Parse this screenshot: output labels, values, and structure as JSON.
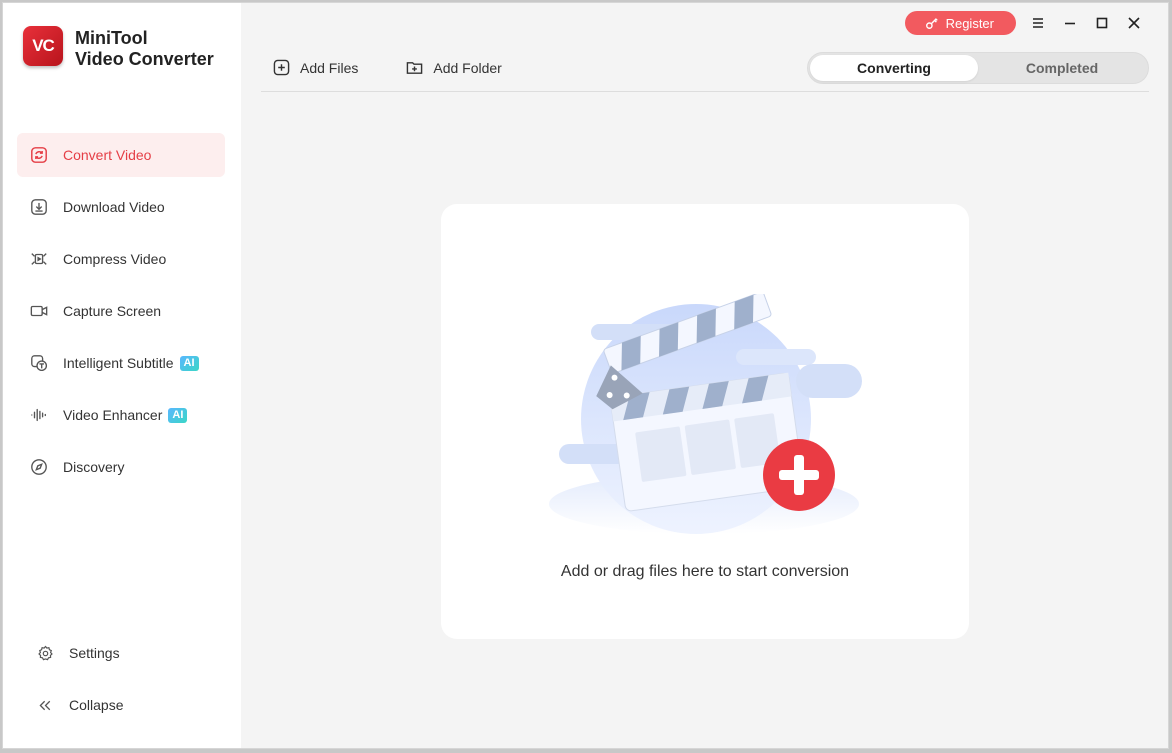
{
  "brand": {
    "logo_text": "VC",
    "line1": "MiniTool",
    "line2": "Video Converter"
  },
  "sidebar": {
    "items": [
      {
        "label": "Convert Video",
        "icon": "convert-icon",
        "active": true
      },
      {
        "label": "Download Video",
        "icon": "download-icon"
      },
      {
        "label": "Compress Video",
        "icon": "compress-icon"
      },
      {
        "label": "Capture Screen",
        "icon": "camera-icon"
      },
      {
        "label": "Intelligent Subtitle",
        "icon": "subtitle-icon",
        "badge": "AI"
      },
      {
        "label": "Video Enhancer",
        "icon": "waveform-icon",
        "badge": "AI"
      },
      {
        "label": "Discovery",
        "icon": "compass-icon"
      }
    ],
    "bottom": {
      "settings_label": "Settings",
      "collapse_label": "Collapse"
    }
  },
  "header": {
    "register_label": "Register"
  },
  "toolbar": {
    "add_files_label": "Add Files",
    "add_folder_label": "Add Folder"
  },
  "tabs": {
    "converting_label": "Converting",
    "completed_label": "Completed",
    "active": "converting"
  },
  "drop_zone": {
    "message": "Add or drag files here to start conversion"
  },
  "colors": {
    "accent": "#e53e46",
    "register_bg": "#f25a5f",
    "active_nav_bg": "#fdeeee",
    "ai_badge": "#3ab6f5"
  }
}
